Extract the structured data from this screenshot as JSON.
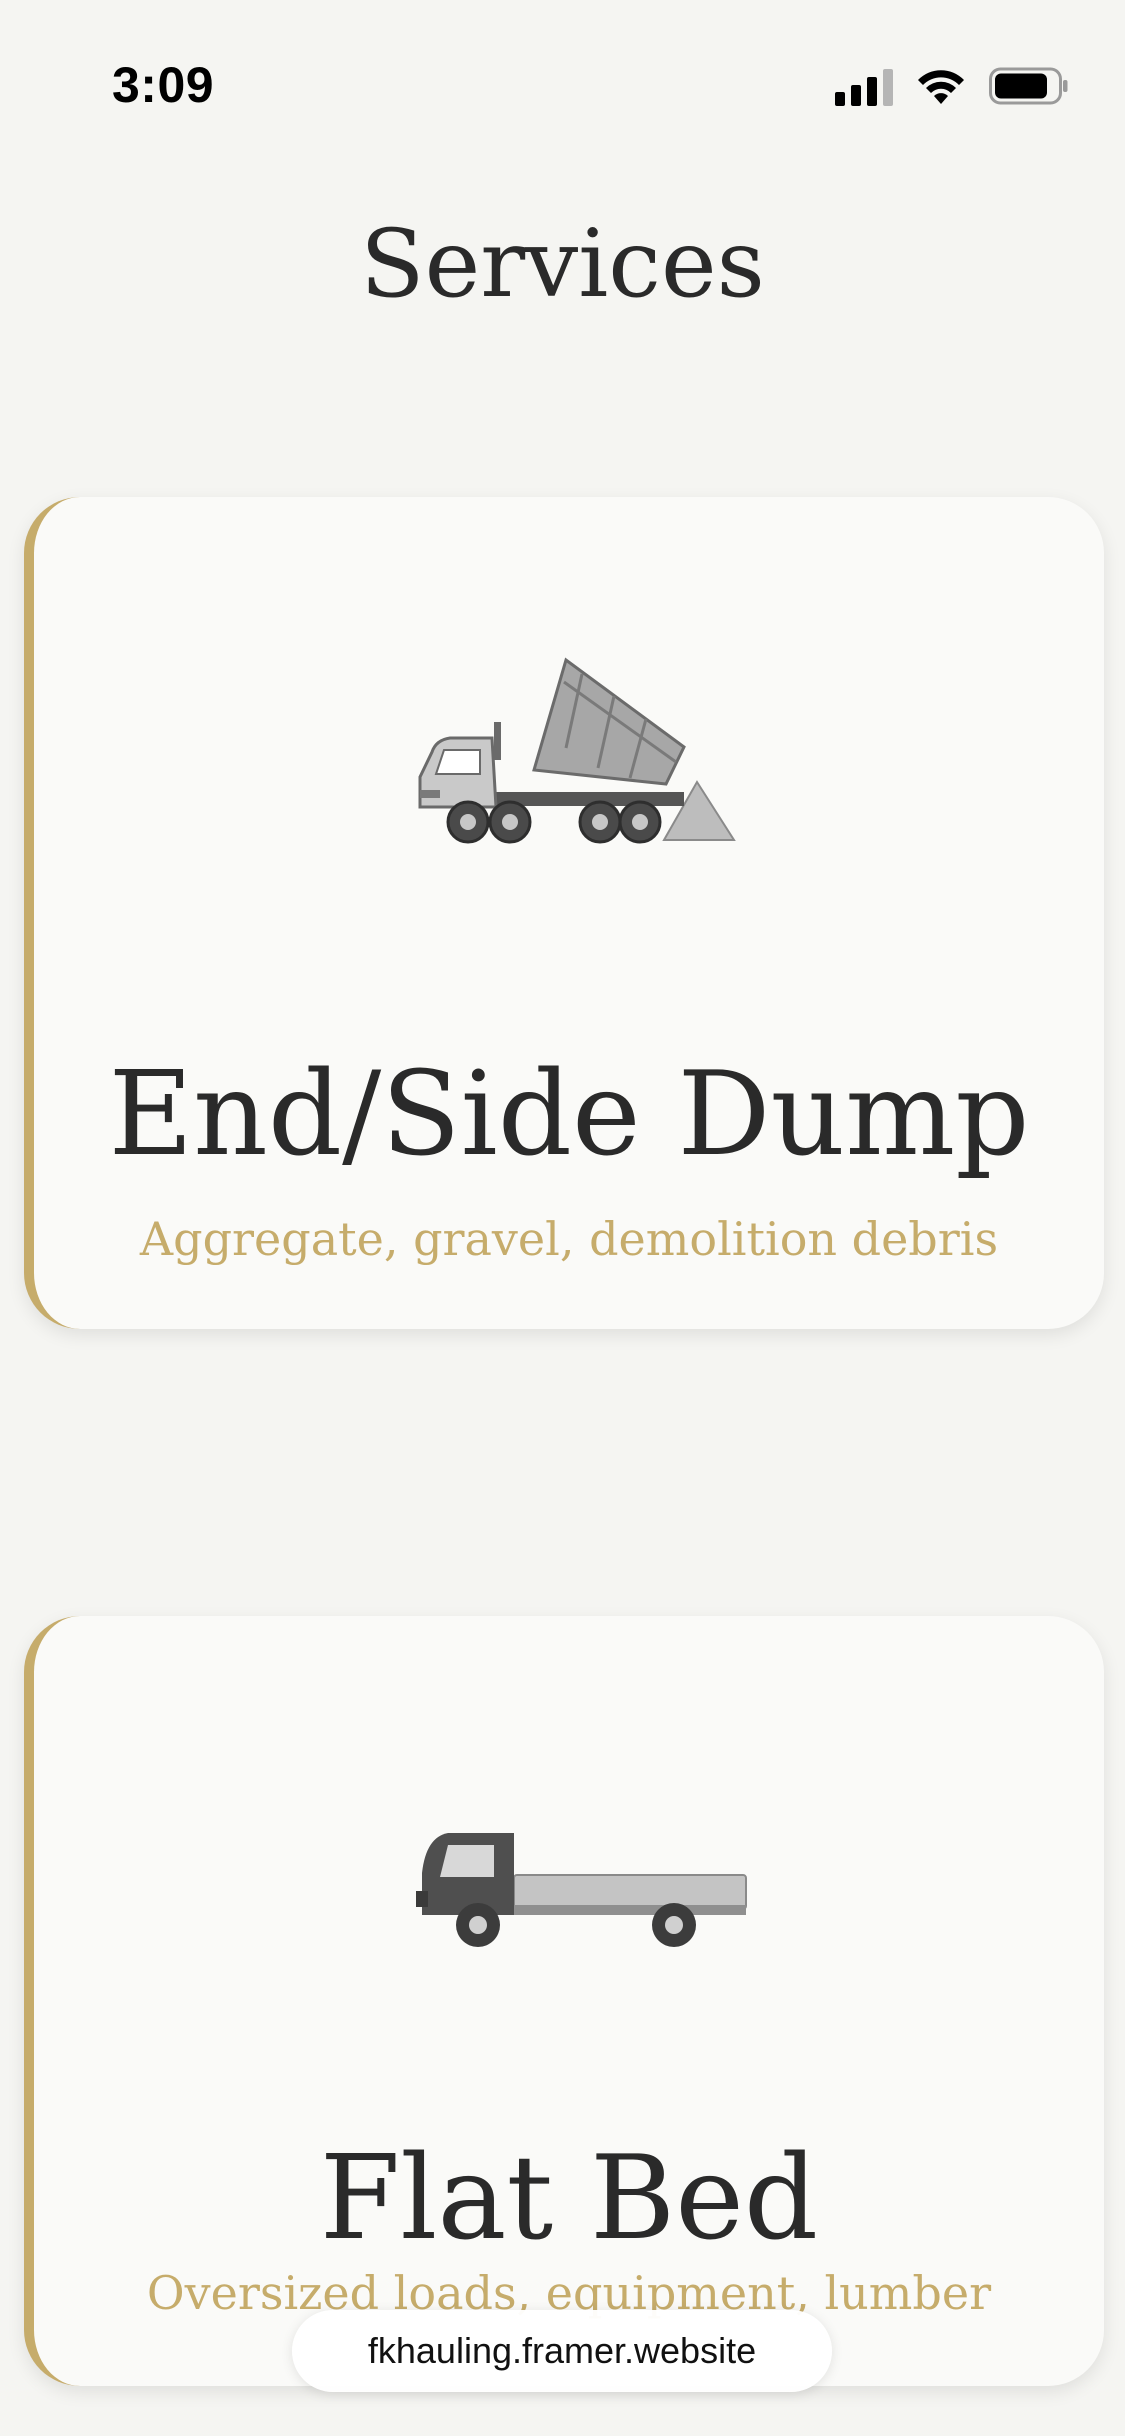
{
  "status_bar": {
    "time": "3:09",
    "icons": [
      "cellular-signal-icon",
      "wifi-icon",
      "battery-icon"
    ]
  },
  "page": {
    "title": "Services"
  },
  "services": [
    {
      "title": "End/Side Dump",
      "subtitle": "Aggregate, gravel, demolition debris",
      "icon": "dump-truck-icon"
    },
    {
      "title": "Flat Bed",
      "subtitle": "Oversized loads, equipment, lumber",
      "icon": "flatbed-truck-icon"
    }
  ],
  "browser": {
    "url": "fkhauling.framer.website"
  },
  "colors": {
    "accent": "#c6ac6b",
    "background": "#f5f5f2",
    "card": "#fafaf8",
    "text": "#2a2a2a"
  }
}
